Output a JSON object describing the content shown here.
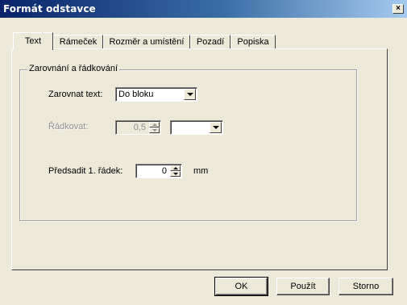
{
  "window": {
    "title": "Formát odstavce",
    "close_glyph": "×"
  },
  "tabs": [
    {
      "label": "Text"
    },
    {
      "label": "Rámeček"
    },
    {
      "label": "Rozměr a umístění"
    },
    {
      "label": "Pozadí"
    },
    {
      "label": "Popiska"
    }
  ],
  "active_tab": "Text",
  "group": {
    "title": "Zarovnání a řádkování",
    "align": {
      "label": "Zarovnat text:",
      "value": "Do bloku"
    },
    "spacing": {
      "label": "Řádkovat:",
      "value": "0,5",
      "unit_value": ""
    },
    "indent": {
      "label": "Předsadit 1. řádek:",
      "value": "0",
      "unit": "mm"
    }
  },
  "buttons": {
    "ok": "OK",
    "apply": "Použít",
    "cancel": "Storno"
  }
}
